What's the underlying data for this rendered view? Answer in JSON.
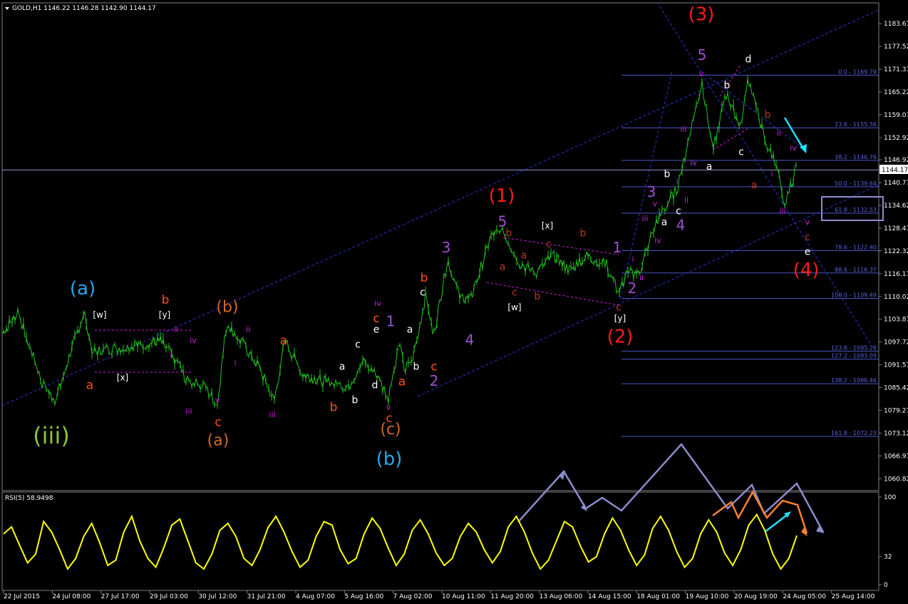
{
  "header": {
    "symbol_info": "GOLD,H1  1146.22 1146.28 1142.90 1144.17"
  },
  "rsi_header": "RSI(5) 58.9498",
  "colors": {
    "background": "#000000",
    "candle": "#22c51e",
    "rsi": "#ffff00",
    "fib": "#4a58c8",
    "channel": "#3636d0",
    "price_line": "#8a96c8",
    "axis_text": "#ffffff",
    "purple_arrows": "#8c8ccc",
    "orange_arrows": "#ff8030",
    "cyan_arrow": "#22e0ff"
  },
  "chart_data": {
    "type": "line",
    "title": "GOLD,H1",
    "price_axis": {
      "ylim": [
        1057.6,
        1189.3
      ],
      "ticks": [
        "1183.67",
        "1177.52",
        "1171.37",
        "1165.22",
        "1159.07",
        "1152.92",
        "1146.92",
        "1140.77",
        "1134.62",
        "1128.47",
        "1122.32",
        "1116.17",
        "1110.02",
        "1103.87",
        "1097.72",
        "1091.57",
        "1085.42",
        "1079.27",
        "1073.12",
        "1066.97",
        "1060.82"
      ],
      "current_price": "1144.17"
    },
    "time_axis": {
      "ticks": [
        "22 Jul 2015",
        "24 Jul 08:00",
        "27 Jul 17:00",
        "29 Jul 03:00",
        "30 Jul 12:00",
        "31 Jul 21:00",
        "4 Aug 07:00",
        "5 Aug 16:00",
        "7 Aug 02:00",
        "10 Aug 11:00",
        "11 Aug 20:00",
        "13 Aug 06:00",
        "14 Aug 15:00",
        "18 Aug 01:00",
        "19 Aug 10:00",
        "20 Aug 19:00",
        "24 Aug 05:00",
        "25 Aug 14:00"
      ]
    },
    "price_path": [
      [
        0,
        1099
      ],
      [
        25,
        1106
      ],
      [
        60,
        1086
      ],
      [
        78,
        1082
      ],
      [
        118,
        1106
      ],
      [
        130,
        1095
      ],
      [
        225,
        1098
      ],
      [
        250,
        1092
      ],
      [
        262,
        1087
      ],
      [
        285,
        1086
      ],
      [
        305,
        1081
      ],
      [
        318,
        1103
      ],
      [
        360,
        1092
      ],
      [
        385,
        1082
      ],
      [
        400,
        1098
      ],
      [
        425,
        1089
      ],
      [
        470,
        1086
      ],
      [
        490,
        1086
      ],
      [
        510,
        1093
      ],
      [
        530,
        1088
      ],
      [
        545,
        1083
      ],
      [
        560,
        1097
      ],
      [
        568,
        1090
      ],
      [
        580,
        1094
      ],
      [
        598,
        1111
      ],
      [
        608,
        1099
      ],
      [
        628,
        1120
      ],
      [
        645,
        1110
      ],
      [
        660,
        1109
      ],
      [
        690,
        1127
      ],
      [
        707,
        1127
      ],
      [
        730,
        1119
      ],
      [
        750,
        1116
      ],
      [
        775,
        1121
      ],
      [
        800,
        1117
      ],
      [
        820,
        1121
      ],
      [
        850,
        1119
      ],
      [
        868,
        1111
      ],
      [
        880,
        1116
      ],
      [
        898,
        1117
      ],
      [
        920,
        1130
      ],
      [
        950,
        1139
      ],
      [
        985,
        1168
      ],
      [
        1000,
        1149
      ],
      [
        1018,
        1165
      ],
      [
        1040,
        1156
      ],
      [
        1050,
        1169
      ],
      [
        1075,
        1151
      ],
      [
        1090,
        1146
      ],
      [
        1100,
        1133
      ],
      [
        1118,
        1146
      ]
    ],
    "fibonacci": [
      {
        "label": "0.0 - 1169.79",
        "value": 1169.79
      },
      {
        "label": "23.6 - 1155.56",
        "value": 1155.56
      },
      {
        "label": "38.2 - 1146.76",
        "value": 1146.76
      },
      {
        "label": "50.0 - 1139.64",
        "value": 1139.64
      },
      {
        "label": "61.8 - 1132.53",
        "value": 1132.53
      },
      {
        "label": "78.6 - 1122.40",
        "value": 1122.4
      },
      {
        "label": "88.6 - 1116.37",
        "value": 1116.37
      },
      {
        "label": "100.0 - 1109.49",
        "value": 1109.49
      },
      {
        "label": "123.6 - 1095.26",
        "value": 1095.26
      },
      {
        "label": "127.2 - 1093.09",
        "value": 1093.09
      },
      {
        "label": "138.2 - 1086.46",
        "value": 1086.46
      },
      {
        "label": "161.8 - 1072.23",
        "value": 1072.23
      }
    ],
    "rsi": {
      "name": "RSI(5)",
      "current": 58.9498,
      "ylim": [
        0,
        100
      ],
      "ticks": [
        "100",
        "32",
        "0"
      ],
      "values": [
        58,
        66,
        45,
        25,
        35,
        72,
        60,
        40,
        18,
        30,
        55,
        70,
        48,
        22,
        28,
        60,
        78,
        50,
        30,
        20,
        42,
        68,
        75,
        50,
        25,
        18,
        35,
        62,
        70,
        55,
        30,
        22,
        40,
        65,
        78,
        60,
        38,
        20,
        28,
        55,
        72,
        68,
        40,
        24,
        30,
        58,
        76,
        64,
        42,
        22,
        35,
        62,
        74,
        58,
        36,
        22,
        30,
        55,
        70,
        60,
        40,
        25,
        38,
        66,
        78,
        60,
        36,
        18,
        28,
        50,
        72,
        66,
        44,
        26,
        32,
        58,
        76,
        62,
        40,
        22,
        34,
        64,
        78,
        62,
        38,
        20,
        30,
        58,
        74,
        60,
        36,
        22,
        40,
        68,
        80,
        62,
        35,
        18,
        30,
        56
      ]
    },
    "wave_labels": [
      {
        "text": "(a)",
        "x": 116,
        "y": 1112,
        "color": "#27a7e6",
        "size": 26
      },
      {
        "text": "(iii)",
        "x": 72,
        "y": 1072,
        "color": "#8bc43c",
        "size": 32
      },
      {
        "text": "[w]",
        "x": 140,
        "y": 1105,
        "color": "#ffffff",
        "size": 12
      },
      {
        "text": "b",
        "x": 232,
        "y": 1109,
        "color": "#ff4f14",
        "size": 17
      },
      {
        "text": "[y]",
        "x": 231,
        "y": 1105,
        "color": "#ffffff",
        "size": 12
      },
      {
        "text": "ii",
        "x": 247,
        "y": 1101,
        "color": "#d020e0",
        "size": 11
      },
      {
        "text": "iv",
        "x": 271,
        "y": 1098,
        "color": "#d020e0",
        "size": 11
      },
      {
        "text": "i",
        "x": 240,
        "y": 1094,
        "color": "#d020e0",
        "size": 11
      },
      {
        "text": "[x]",
        "x": 172,
        "y": 1088,
        "color": "#ffffff",
        "size": 12
      },
      {
        "text": "a",
        "x": 126,
        "y": 1086,
        "color": "#ff4f14",
        "size": 17
      },
      {
        "text": "iii",
        "x": 265,
        "y": 1079,
        "color": "#d020e0",
        "size": 11
      },
      {
        "text": "v",
        "x": 305,
        "y": 1082,
        "color": "#d020e0",
        "size": 11
      },
      {
        "text": "c",
        "x": 306,
        "y": 1076,
        "color": "#ff4f14",
        "size": 17
      },
      {
        "text": "(a)",
        "x": 306,
        "y": 1071,
        "color": "#d2691e",
        "size": 22
      },
      {
        "text": "(b)",
        "x": 319,
        "y": 1107,
        "color": "#d2691e",
        "size": 22
      },
      {
        "text": "ii",
        "x": 348,
        "y": 1101,
        "color": "#d020e0",
        "size": 11
      },
      {
        "text": "i",
        "x": 330,
        "y": 1092,
        "color": "#d020e0",
        "size": 11
      },
      {
        "text": "a",
        "x": 398,
        "y": 1098,
        "color": "#ff4f14",
        "size": 17
      },
      {
        "text": "iii",
        "x": 382,
        "y": 1078,
        "color": "#d020e0",
        "size": 11
      },
      {
        "text": "b",
        "x": 468,
        "y": 1080,
        "color": "#ff4f14",
        "size": 17
      },
      {
        "text": "a",
        "x": 480,
        "y": 1091,
        "color": "#ffffff",
        "size": 14
      },
      {
        "text": "b",
        "x": 498,
        "y": 1082,
        "color": "#ffffff",
        "size": 14
      },
      {
        "text": "c",
        "x": 502,
        "y": 1097,
        "color": "#ffffff",
        "size": 14
      },
      {
        "text": "d",
        "x": 526,
        "y": 1086,
        "color": "#ffffff",
        "size": 14
      },
      {
        "text": "iv",
        "x": 530,
        "y": 1108,
        "color": "#d020e0",
        "size": 11
      },
      {
        "text": "c",
        "x": 528,
        "y": 1104,
        "color": "#ff4f14",
        "size": 17
      },
      {
        "text": "e",
        "x": 528,
        "y": 1101,
        "color": "#ffffff",
        "size": 14
      },
      {
        "text": "1",
        "x": 548,
        "y": 1103,
        "color": "#a050d0",
        "size": 20
      },
      {
        "text": "v",
        "x": 545,
        "y": 1080,
        "color": "#d020e0",
        "size": 11
      },
      {
        "text": "c",
        "x": 546,
        "y": 1077,
        "color": "#ff4f14",
        "size": 17
      },
      {
        "text": "(c)",
        "x": 548,
        "y": 1074,
        "color": "#d2691e",
        "size": 22
      },
      {
        "text": "(b)",
        "x": 546,
        "y": 1066,
        "color": "#27a7e6",
        "size": 26
      },
      {
        "text": "a",
        "x": 575,
        "y": 1101,
        "color": "#ffffff",
        "size": 14
      },
      {
        "text": "a",
        "x": 564,
        "y": 1087,
        "color": "#ff4f14",
        "size": 17
      },
      {
        "text": "b",
        "x": 584,
        "y": 1091,
        "color": "#ffffff",
        "size": 14
      },
      {
        "text": "c",
        "x": 609,
        "y": 1091,
        "color": "#ff4f14",
        "size": 17
      },
      {
        "text": "2",
        "x": 609,
        "y": 1087,
        "color": "#a050d0",
        "size": 20
      },
      {
        "text": "c",
        "x": 593,
        "y": 1111,
        "color": "#ffffff",
        "size": 14
      },
      {
        "text": "b",
        "x": 595,
        "y": 1115,
        "color": "#ff4f14",
        "size": 17
      },
      {
        "text": "3",
        "x": 626,
        "y": 1123,
        "color": "#a050d0",
        "size": 20
      },
      {
        "text": "4",
        "x": 659,
        "y": 1098,
        "color": "#a050d0",
        "size": 20
      },
      {
        "text": "(1)",
        "x": 704,
        "y": 1137,
        "color": "#ff1a1a",
        "size": 26
      },
      {
        "text": "5",
        "x": 705,
        "y": 1130,
        "color": "#a050d0",
        "size": 20
      },
      {
        "text": "b",
        "x": 714,
        "y": 1127,
        "color": "#b83820",
        "size": 14
      },
      {
        "text": "a",
        "x": 705,
        "y": 1118,
        "color": "#b83820",
        "size": 14
      },
      {
        "text": "a",
        "x": 735,
        "y": 1121,
        "color": "#b83820",
        "size": 14
      },
      {
        "text": "c",
        "x": 722,
        "y": 1111,
        "color": "#b83820",
        "size": 14
      },
      {
        "text": "[w]",
        "x": 722,
        "y": 1107,
        "color": "#ffffff",
        "size": 12
      },
      {
        "text": "c",
        "x": 770,
        "y": 1124,
        "color": "#b83820",
        "size": 14
      },
      {
        "text": "[x]",
        "x": 768,
        "y": 1129,
        "color": "#ffffff",
        "size": 12
      },
      {
        "text": "b",
        "x": 754,
        "y": 1110,
        "color": "#b83820",
        "size": 14
      },
      {
        "text": "b",
        "x": 818,
        "y": 1127,
        "color": "#b83820",
        "size": 14
      },
      {
        "text": "1",
        "x": 866,
        "y": 1123,
        "color": "#a050d0",
        "size": 20
      },
      {
        "text": "c",
        "x": 868,
        "y": 1107,
        "color": "#b83820",
        "size": 14
      },
      {
        "text": "[y]",
        "x": 870,
        "y": 1104,
        "color": "#ffffff",
        "size": 12
      },
      {
        "text": "(2)",
        "x": 870,
        "y": 1099,
        "color": "#ff1a1a",
        "size": 26
      },
      {
        "text": "i",
        "x": 888,
        "y": 1120,
        "color": "#d020e0",
        "size": 11
      },
      {
        "text": "2",
        "x": 887,
        "y": 1112,
        "color": "#a050d0",
        "size": 20
      },
      {
        "text": "ii",
        "x": 900,
        "y": 1115,
        "color": "#d020e0",
        "size": 11
      },
      {
        "text": "iii",
        "x": 905,
        "y": 1131,
        "color": "#d020e0",
        "size": 11
      },
      {
        "text": "iv",
        "x": 923,
        "y": 1125,
        "color": "#d020e0",
        "size": 11
      },
      {
        "text": "a",
        "x": 932,
        "y": 1130,
        "color": "#ffffff",
        "size": 14
      },
      {
        "text": "3",
        "x": 914,
        "y": 1138,
        "color": "#a050d0",
        "size": 20
      },
      {
        "text": "v",
        "x": 919,
        "y": 1135,
        "color": "#d020e0",
        "size": 11
      },
      {
        "text": "b",
        "x": 936,
        "y": 1143,
        "color": "#ffffff",
        "size": 14
      },
      {
        "text": "i",
        "x": 950,
        "y": 1141,
        "color": "#d020e0",
        "size": 11
      },
      {
        "text": "ii",
        "x": 963,
        "y": 1136,
        "color": "#d020e0",
        "size": 11
      },
      {
        "text": "c",
        "x": 952,
        "y": 1133,
        "color": "#ffffff",
        "size": 14
      },
      {
        "text": "4",
        "x": 955,
        "y": 1129,
        "color": "#a050d0",
        "size": 20
      },
      {
        "text": "iii",
        "x": 959,
        "y": 1155,
        "color": "#d020e0",
        "size": 11
      },
      {
        "text": "iv",
        "x": 973,
        "y": 1146,
        "color": "#d020e0",
        "size": 11
      },
      {
        "text": "a",
        "x": 995,
        "y": 1145,
        "color": "#ffffff",
        "size": 14
      },
      {
        "text": "v",
        "x": 984,
        "y": 1170,
        "color": "#d020e0",
        "size": 11
      },
      {
        "text": "5",
        "x": 985,
        "y": 1175,
        "color": "#a050d0",
        "size": 20
      },
      {
        "text": "(3)",
        "x": 984,
        "y": 1186,
        "color": "#ff1a1a",
        "size": 26
      },
      {
        "text": "b",
        "x": 1020,
        "y": 1167,
        "color": "#ffffff",
        "size": 14
      },
      {
        "text": "d",
        "x": 1050,
        "y": 1174,
        "color": "#ffffff",
        "size": 14
      },
      {
        "text": "c",
        "x": 1040,
        "y": 1149,
        "color": "#ffffff",
        "size": 14
      },
      {
        "text": "b",
        "x": 1077,
        "y": 1159,
        "color": "#b83820",
        "size": 14
      },
      {
        "text": "ii",
        "x": 1093,
        "y": 1154,
        "color": "#d020e0",
        "size": 11
      },
      {
        "text": "iv",
        "x": 1113,
        "y": 1150,
        "color": "#d020e0",
        "size": 11
      },
      {
        "text": "i",
        "x": 1083,
        "y": 1143,
        "color": "#d020e0",
        "size": 11
      },
      {
        "text": "a",
        "x": 1058,
        "y": 1140,
        "color": "#b83820",
        "size": 14
      },
      {
        "text": "iii",
        "x": 1098,
        "y": 1133,
        "color": "#d020e0",
        "size": 11
      },
      {
        "text": "v",
        "x": 1133,
        "y": 1130,
        "color": "#d020e0",
        "size": 11
      },
      {
        "text": "c",
        "x": 1133,
        "y": 1126,
        "color": "#b83820",
        "size": 14
      },
      {
        "text": "e",
        "x": 1133,
        "y": 1122,
        "color": "#ffffff",
        "size": 14
      },
      {
        "text": "(4)",
        "x": 1131,
        "y": 1117,
        "color": "#ff1a1a",
        "size": 26
      }
    ]
  }
}
